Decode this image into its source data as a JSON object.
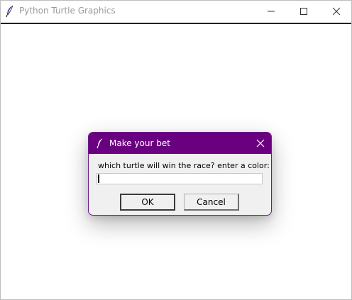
{
  "window": {
    "title": "Python Turtle Graphics",
    "icon": "feather-icon"
  },
  "dialog": {
    "title": "Make your bet",
    "icon": "feather-icon",
    "prompt": "which turtle will win the race? enter a color:",
    "input_value": "",
    "ok_label": "OK",
    "cancel_label": "Cancel",
    "accent_color": "#6a0080"
  }
}
